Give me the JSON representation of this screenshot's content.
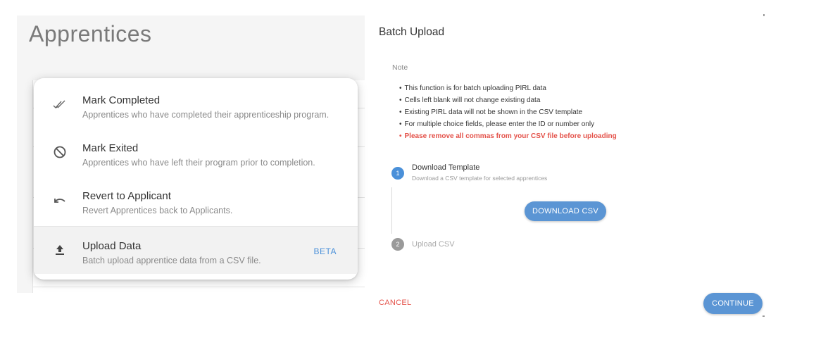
{
  "left": {
    "page_title": "Apprentices",
    "menu": [
      {
        "icon": "double-check-icon",
        "title": "Mark Completed",
        "subtitle": "Apprentices who have completed their apprenticeship program.",
        "badge": ""
      },
      {
        "icon": "block-icon",
        "title": "Mark Exited",
        "subtitle": "Apprentices who have left their program prior to completion.",
        "badge": ""
      },
      {
        "icon": "undo-icon",
        "title": "Revert to Applicant",
        "subtitle": "Revert Apprentices back to Applicants.",
        "badge": ""
      },
      {
        "icon": "upload-icon",
        "title": "Upload Data",
        "subtitle": "Batch upload apprentice data from a CSV file.",
        "badge": "BETA"
      }
    ]
  },
  "dialog": {
    "title": "Batch Upload",
    "note_label": "Note",
    "bullet": "•",
    "notes": [
      "This function is for batch uploading PIRL data",
      "Cells left blank will not change existing data",
      "Existing PIRL data will not be shown in the CSV template",
      "For multiple choice fields, please enter the ID or number only"
    ],
    "warning": "Please remove all commas from your CSV file before uploading",
    "steps": [
      {
        "number": "1",
        "title": "Download Template",
        "subtitle": "Download a CSV template for selected apprentices",
        "button": "DOWNLOAD CSV"
      },
      {
        "number": "2",
        "title": "Upload CSV"
      }
    ],
    "cancel_label": "CANCEL",
    "continue_label": "CONTINUE"
  },
  "colors": {
    "accent": "#5b95d4",
    "step_active": "#4a90d9",
    "warning": "#e4524a",
    "badge": "#4a90d9"
  }
}
